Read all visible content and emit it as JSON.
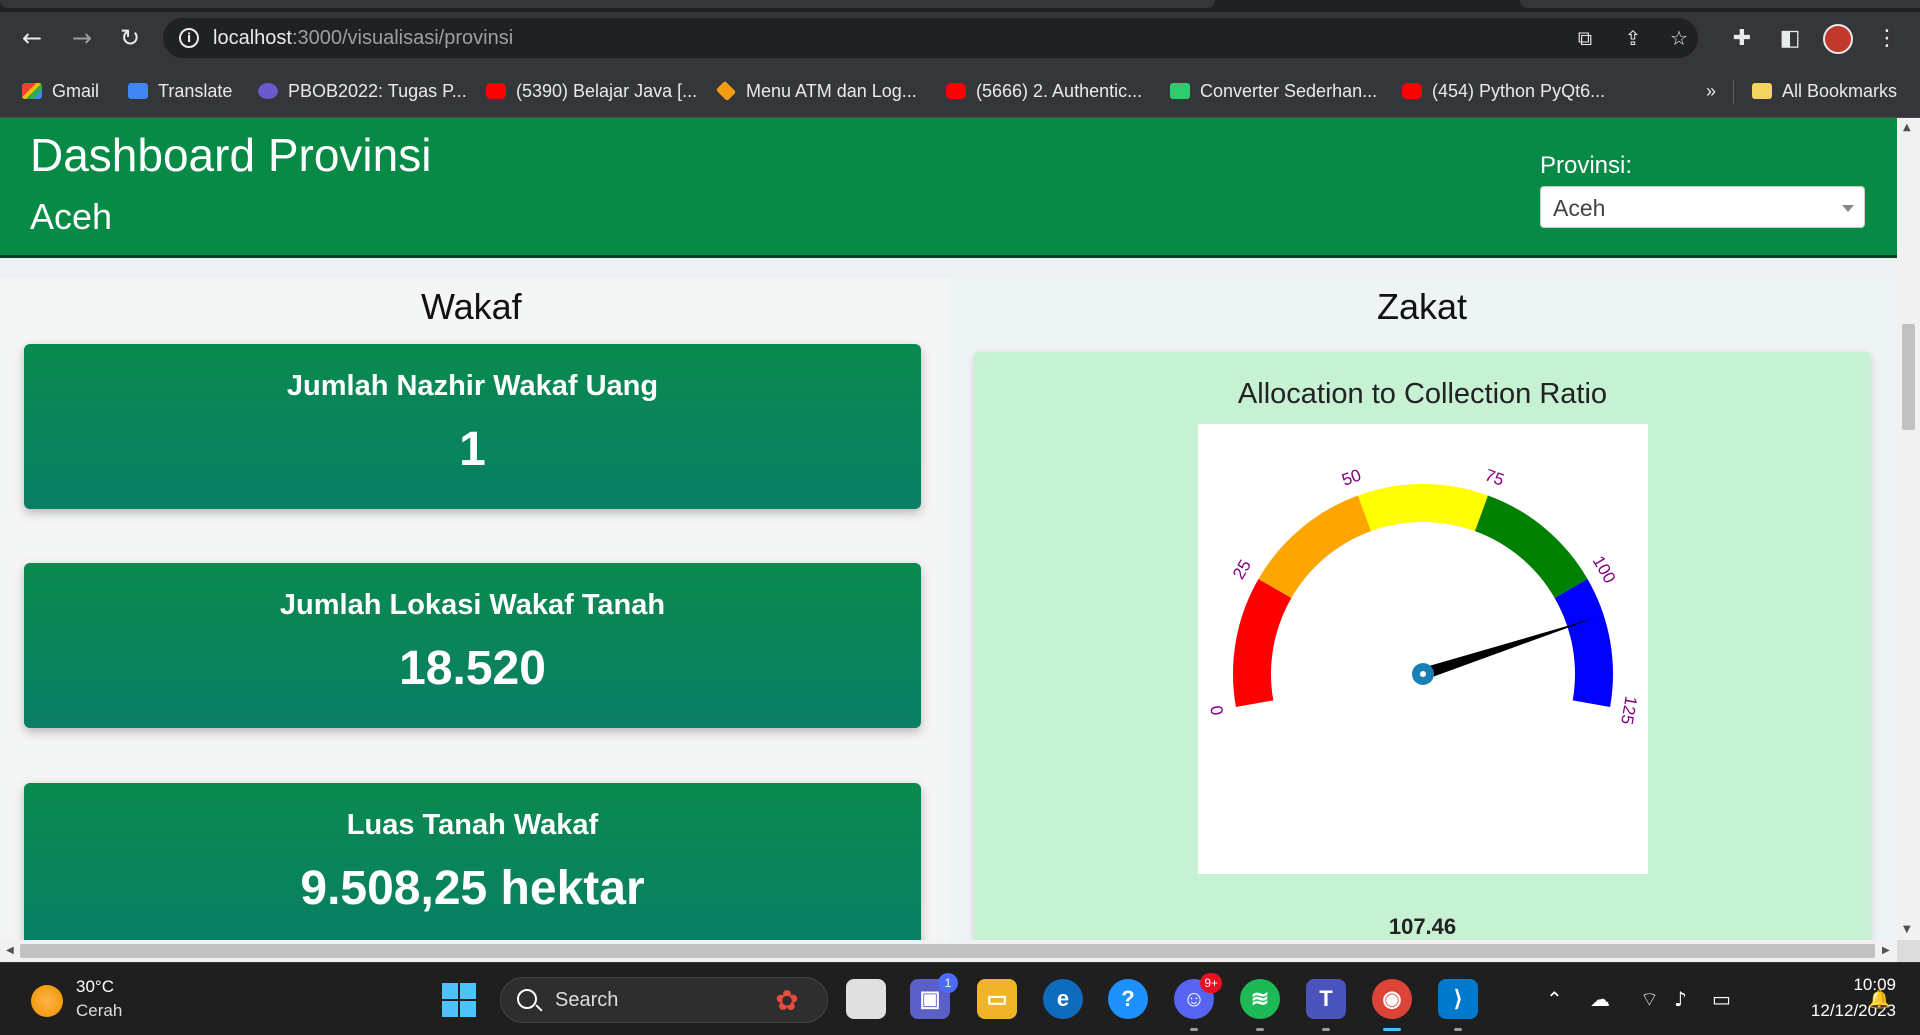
{
  "browser": {
    "url_host": "localhost",
    "url_path": ":3000/visualisasi/provinsi",
    "bookmarks": [
      {
        "label": "Gmail",
        "icon": "gmail-icon"
      },
      {
        "label": "Translate",
        "icon": "translate-icon"
      },
      {
        "label": "PBOB2022: Tugas P...",
        "icon": "pbo-icon"
      },
      {
        "label": "(5390) Belajar Java [...",
        "icon": "youtube-icon"
      },
      {
        "label": "Menu ATM dan Log...",
        "icon": "box-icon"
      },
      {
        "label": "(5666) 2. Authentic...",
        "icon": "youtube-icon"
      },
      {
        "label": "Converter Sederhan...",
        "icon": "cube-icon"
      },
      {
        "label": "(454) Python PyQt6...",
        "icon": "youtube-icon"
      }
    ],
    "more_bookmarks": "»",
    "all_bookmarks": "All Bookmarks"
  },
  "header": {
    "title": "Dashboard Provinsi",
    "subtitle": "Aceh",
    "province_label": "Provinsi:",
    "province_selected": "Aceh"
  },
  "wakaf": {
    "section_title": "Wakaf",
    "cards": [
      {
        "label": "Jumlah Nazhir Wakaf Uang",
        "value": "1"
      },
      {
        "label": "Jumlah Lokasi Wakaf Tanah",
        "value": "18.520"
      },
      {
        "label": "Luas Tanah Wakaf",
        "value": "9.508,25 hektar"
      }
    ]
  },
  "zakat": {
    "section_title": "Zakat",
    "gauge_title": "Allocation to Collection Ratio",
    "gauge_value": "107.46"
  },
  "chart_data": {
    "type": "gauge",
    "title": "Allocation to Collection Ratio",
    "min": 0,
    "max": 125,
    "ticks": [
      "0",
      "25",
      "50",
      "75",
      "100",
      "125"
    ],
    "value": 107.46,
    "bands": [
      {
        "from": 0,
        "to": 25,
        "color": "#ff0000"
      },
      {
        "from": 25,
        "to": 50,
        "color": "#ffa500"
      },
      {
        "from": 50,
        "to": 75,
        "color": "#ffff00"
      },
      {
        "from": 75,
        "to": 100,
        "color": "#008000"
      },
      {
        "from": 100,
        "to": 125,
        "color": "#0000ff"
      }
    ],
    "tick_color": "#800080",
    "needle_color": "#000000",
    "hub_color": "#1a7fb5"
  },
  "taskbar": {
    "temperature": "30°C",
    "condition": "Cerah",
    "search_placeholder": "Search",
    "teams_badge": "1",
    "discord_badge": "9+",
    "time": "10:09",
    "date": "12/12/2023"
  },
  "colors": {
    "header_green": "#068a45",
    "card_green": "#0a8a4e",
    "zakat_card_bg": "#c6f1d3"
  }
}
